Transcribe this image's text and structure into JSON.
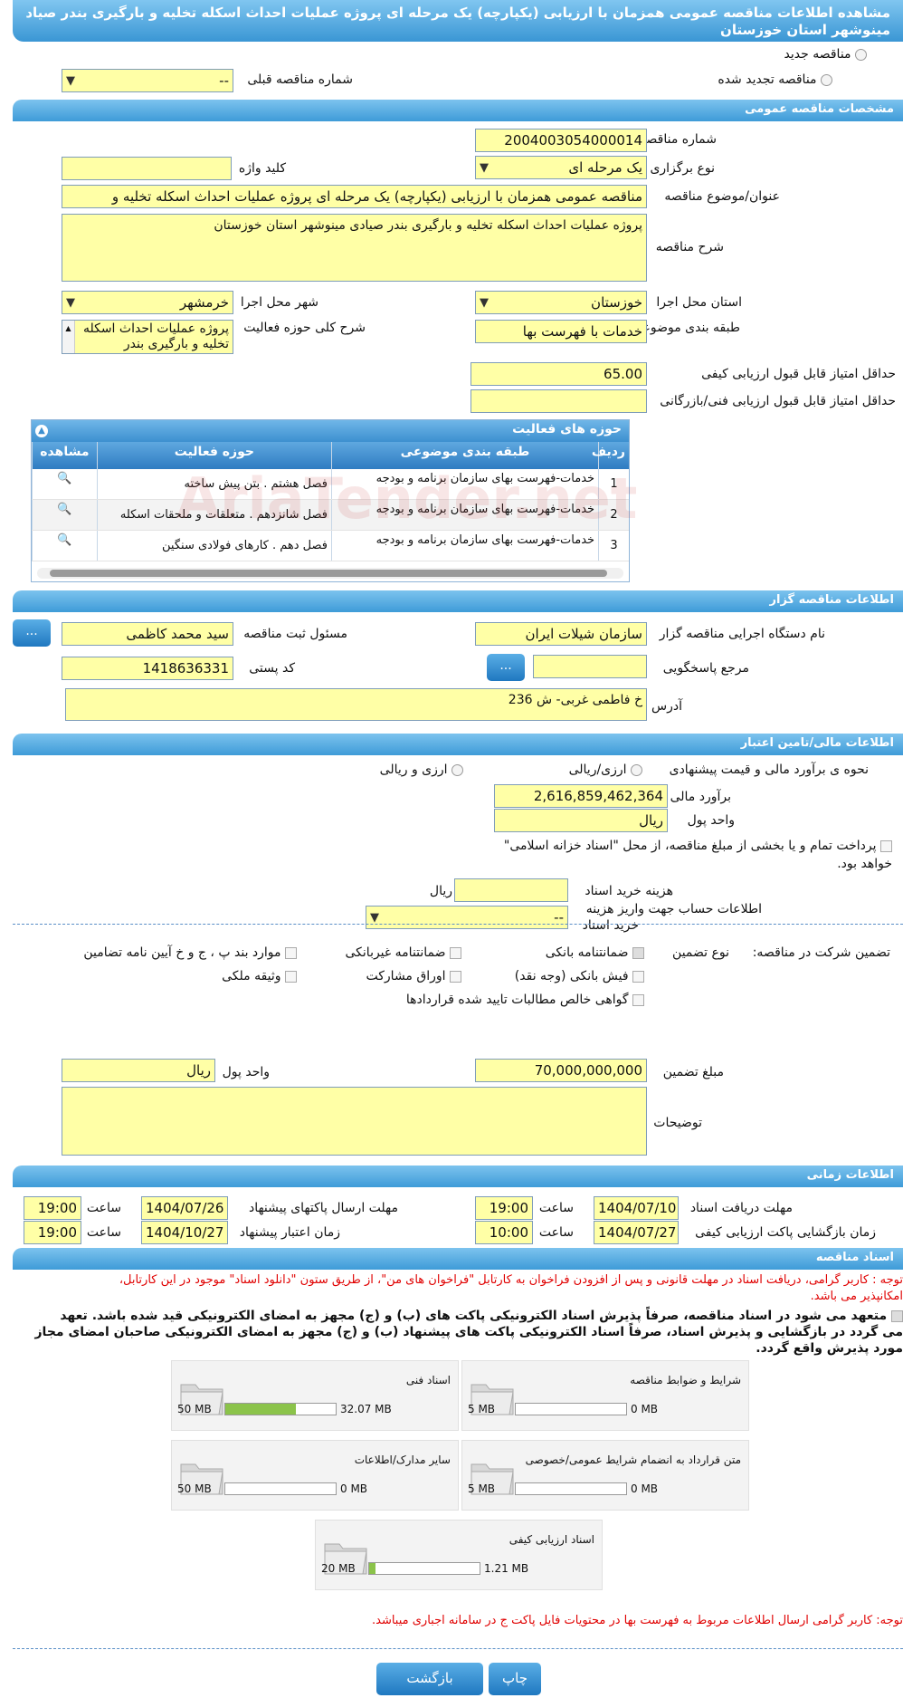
{
  "header": {
    "title_line1": "مشاهده اطلاعات مناقصه عمومی همزمان با ارزیابی (یکپارچه) یک مرحله ای پروژه عملیات احداث اسکله تخلیه و بارگیری بندر صیادی",
    "title_line2": "مینوشهر استان خوزستان"
  },
  "top": {
    "new_label": "مناقصه جدید",
    "renewed_label": "مناقصه تجدید شده",
    "prev_label": "شماره مناقصه قبلی",
    "prev_value": "--"
  },
  "general": {
    "title": "مشخصات مناقصه عمومی",
    "number_label": "شماره مناقصه",
    "number": "2004003054000014",
    "type_label": "نوع برگزاری",
    "type_value": "یک مرحله ای",
    "keyword_label": "کلید واژه",
    "keyword": "",
    "subject_label": "عنوان/موضوع مناقصه",
    "subject": "مناقصه عمومی همزمان با ارزیابی (یکپارچه) یک مرحله ای پروژه عملیات احداث اسکله تخلیه و",
    "desc_label": "شرح مناقصه",
    "desc": "پروژه عملیات احداث اسکله تخلیه و بارگیری بندر صیادی مینوشهر استان خوزستان",
    "province_label": "استان محل اجرا",
    "province": "خوزستان",
    "city_label": "شهر محل اجرا",
    "city": "خرمشهر",
    "category_label": "طبقه بندی موضوعی",
    "category": "خدمات با فهرست بها",
    "scope_label": "شرح کلی حوزه فعالیت",
    "scope": "پروژه عملیات احداث اسکله تخلیه و بارگیری بندر",
    "min_quality_label": "حداقل امتیاز قابل قبول ارزیابی کیفی",
    "min_quality": "65.00",
    "min_tech_label": "حداقل امتیاز قابل قبول ارزیابی فنی/بازرگانی",
    "min_tech": ""
  },
  "grid": {
    "title": "حوزه های فعالیت",
    "headers": [
      "ردیف",
      "طبقه بندی موضوعی",
      "حوزه فعالیت",
      "مشاهده"
    ],
    "rows": [
      {
        "n": "1",
        "cat": "خدمات-فهرست بهای سازمان برنامه و بودجه",
        "act": "فصل هشتم . بتن پیش ساخته"
      },
      {
        "n": "2",
        "cat": "خدمات-فهرست بهای سازمان برنامه و بودجه",
        "act": "فصل شانزدهم . متعلقات و ملحقات اسکله"
      },
      {
        "n": "3",
        "cat": "خدمات-فهرست بهای سازمان برنامه و بودجه",
        "act": "فصل دهم . کارهای فولادی سنگین"
      }
    ],
    "watermark": "AriaTender.net"
  },
  "org": {
    "title": "اطلاعات مناقصه گزار",
    "name_label": "نام دستگاه اجرایی مناقصه گزار",
    "name": "سازمان شیلات ایران",
    "resp_label": "مسئول ثبت مناقصه",
    "resp": "سید محمد کاظمی",
    "ref_label": "مرجع پاسخگویی",
    "ref": "",
    "postal_label": "کد پستی",
    "postal": "1418636331",
    "address_label": "آدرس",
    "address": "خ فاطمی غربی- ش 236",
    "dots": "..."
  },
  "finance": {
    "title": "اطلاعات مالی/تامین اعتبار",
    "method_label": "نحوه ی برآورد مالی و قیمت پیشنهادی",
    "opt1": "ارزی/ریالی",
    "opt2": "ارزی و ریالی",
    "estimate_label": "برآورد مالی",
    "estimate": "2,616,859,462,364",
    "currency_label": "واحد پول",
    "currency": "ریال",
    "treasury_text": "پرداخت تمام و یا بخشی از مبلغ مناقصه، از محل \"اسناد خزانه اسلامی\"",
    "treasury_text2": "خواهد بود.",
    "doc_fee_label": "هزینه خرید اسناد",
    "doc_fee": "",
    "doc_fee_unit": "ریال",
    "account_label": "اطلاعات حساب جهت واریز هزینه",
    "account_label2": "خرید اسناد",
    "account_value": "--"
  },
  "guarantee": {
    "participation_label": "تضمین شرکت در مناقصه:",
    "type_label": "نوع تضمین",
    "opts": [
      "ضمانتنامه بانکی",
      "ضمانتنامه غیربانکی",
      "موارد بند پ ، ج و خ آیین نامه تضامین",
      "فیش بانکی (وجه نقد)",
      "اوراق مشارکت",
      "وثیقه ملکی",
      "گواهی خالص مطالبات تایید شده قراردادها"
    ],
    "amount_label": "مبلغ تضمین",
    "amount": "70,000,000,000",
    "currency_label": "واحد پول",
    "currency": "ریال",
    "notes_label": "توضیحات",
    "notes": ""
  },
  "timing": {
    "title": "اطلاعات زمانی",
    "receive_label": "مهلت دریافت اسناد",
    "receive_date": "1404/07/10",
    "receive_time": "19:00",
    "send_label": "مهلت ارسال پاکتهای پیشنهاد",
    "send_date": "1404/07/26",
    "send_time": "19:00",
    "open_label": "زمان بازگشایی پاکت ارزیابی کیفی",
    "open_date": "1404/07/27",
    "open_time": "10:00",
    "valid_label": "زمان اعتبار پیشنهاد",
    "valid_date": "1404/10/27",
    "valid_time": "19:00",
    "hour_label": "ساعت"
  },
  "docs": {
    "title": "اسناد مناقصه",
    "note1": "توجه : کاربر گرامی، دریافت اسناد در مهلت قانونی و پس از افزودن فراخوان به کارتابل \"فراخوان های من\"، از طریق ستون \"دانلود اسناد\" موجود در این کارتابل،",
    "note1b": "امکانپذیر می باشد.",
    "commit1": "متعهد می شود در اسناد مناقصه، صرفاً پذیرش اسناد الکترونیکی پاکت های (ب) و (ج) مجهز به امضای الکترونیکی قید شده باشد. تعهد",
    "commit2": "می گردد در بازگشایی و پذیرش اسناد، صرفاً اسناد الکترونیکی پاکت های پیشنهاد (ب) و (ج) مجهز به امضای الکترونیکی صاحبان امضای مجاز",
    "commit3": "مورد پذیرش واقع گردد.",
    "files": [
      {
        "name": "شرایط و ضوابط مناقصه",
        "min": "0 MB",
        "max": "5 MB",
        "fill": 0
      },
      {
        "name": "اسناد فنی",
        "min": "32.07 MB",
        "max": "50 MB",
        "fill": 0.64
      },
      {
        "name": "متن قرارداد به انضمام شرایط عمومی/خصوصی",
        "min": "0 MB",
        "max": "5 MB",
        "fill": 0
      },
      {
        "name": "سایر مدارک/اطلاعات",
        "min": "0 MB",
        "max": "50 MB",
        "fill": 0
      },
      {
        "name": "اسناد ارزیابی کیفی",
        "min": "1.21 MB",
        "max": "20 MB",
        "fill": 0.06
      }
    ],
    "note2": "توجه: کاربر گرامی ارسال اطلاعات مربوط به فهرست بها در محتویات فایل پاکت ج در سامانه اجباری میباشد."
  },
  "buttons": {
    "print": "چاپ",
    "back": "بازگشت"
  }
}
